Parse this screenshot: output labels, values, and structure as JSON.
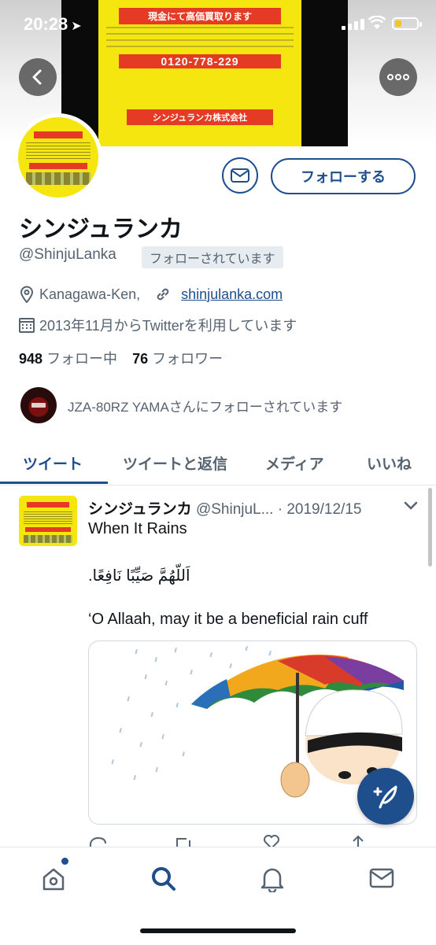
{
  "status_bar": {
    "time": "20:28"
  },
  "banner": {
    "flyer_title": "現金にて高価買取ります",
    "flyer_phone": "0120-778-229",
    "flyer_company": "シンジュランカ株式会社"
  },
  "profile": {
    "display_name": "シンジュランカ",
    "handle": "@ShinjuLanka",
    "follows_you": "フォローされています",
    "location": "Kanagawa-Ken,",
    "website": "shinjulanka.com",
    "joined": "2013年11月からTwitterを利用しています",
    "following_count": "948",
    "following_label": "フォロー中",
    "followers_count": "76",
    "followers_label": "フォロワー",
    "followed_by": "JZA-80RZ YAMAさんにフォローされています",
    "follow_button": "フォローする"
  },
  "tabs": [
    "ツイート",
    "ツイートと返信",
    "メディア",
    "いいね"
  ],
  "tweet": {
    "name": "シンジュランカ",
    "handle": "@ShinjuL...",
    "date": "· 2019/12/15",
    "line1": "When It Rains",
    "line2": "اَللّهُمَّ صَيِّبًا نَافِعًا.",
    "line3": "‘O Allaah, may it be a beneficial rain cuff"
  },
  "colors": {
    "accent": "#1f4e8c",
    "muted": "#566370"
  }
}
